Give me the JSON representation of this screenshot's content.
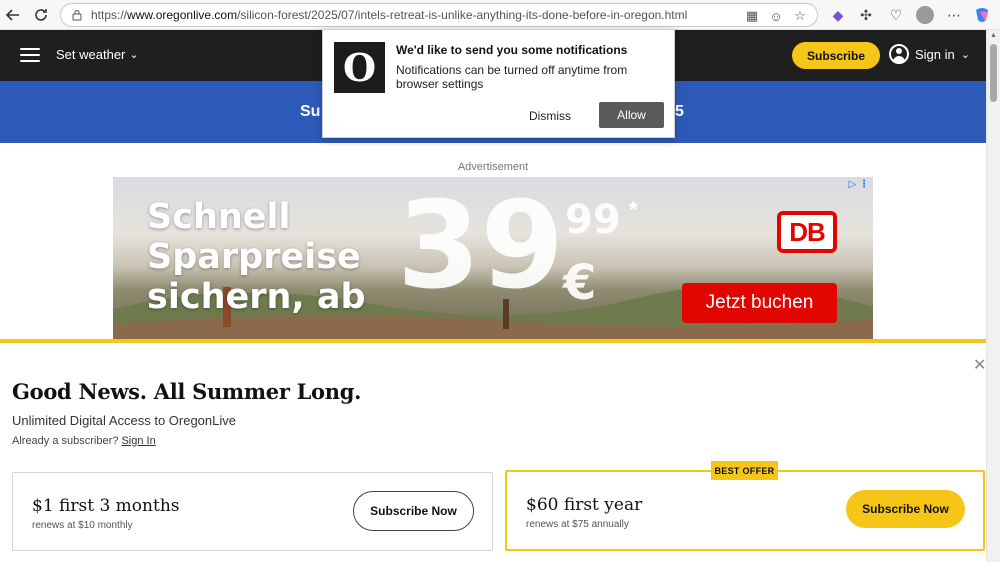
{
  "browser": {
    "url_prefix": "https://",
    "url_host": "www.oregonlive.com",
    "url_path": "/silicon-forest/2025/07/intels-retreat-is-unlike-anything-its-done-before-in-oregon.html",
    "icons": [
      "back-icon",
      "refresh-icon",
      "site-info-icon",
      "app-icon",
      "tracking-icon",
      "favorite-star-icon",
      "extension-icon",
      "puzzle-icon",
      "heart-icon",
      "profile-avatar",
      "more-icon",
      "copilot-icon"
    ]
  },
  "header": {
    "weather_label": "Set weather",
    "subscribe_label": "Subscribe",
    "signin_label": "Sign in"
  },
  "banner": {
    "text_left": "Su",
    "text_right": "5"
  },
  "notification": {
    "logo_glyph": "O",
    "title": "We'd like to send you some notifications",
    "body": "Notifications can be turned off anytime from browser settings",
    "dismiss_label": "Dismiss",
    "allow_label": "Allow"
  },
  "ad": {
    "label": "Advertisement",
    "headline_line1": "Schnell",
    "headline_line2": "Sparpreise",
    "headline_line3": "sichern, ab",
    "price_main": "39",
    "price_cents": "99",
    "price_star": "*",
    "currency": "€",
    "brand": "DB",
    "cta": "Jetzt buchen"
  },
  "paywall": {
    "close_glyph": "✕",
    "title": "Good News. All Summer Long.",
    "subtitle": "Unlimited Digital Access to OregonLive",
    "already_text": "Already a subscriber?",
    "signin_link": "Sign In",
    "best_offer_badge": "BEST OFFER",
    "offers": [
      {
        "price": "$1 first 3 months",
        "renew": "renews at $10 monthly",
        "button": "Subscribe Now"
      },
      {
        "price": "$60 first year",
        "renew": "renews at $75 annually",
        "button": "Subscribe Now"
      }
    ]
  },
  "colors": {
    "header_bg": "#1f1f1f",
    "banner_bg": "#2d5ab9",
    "accent_yellow": "#f5c518",
    "db_red": "#e10600"
  }
}
